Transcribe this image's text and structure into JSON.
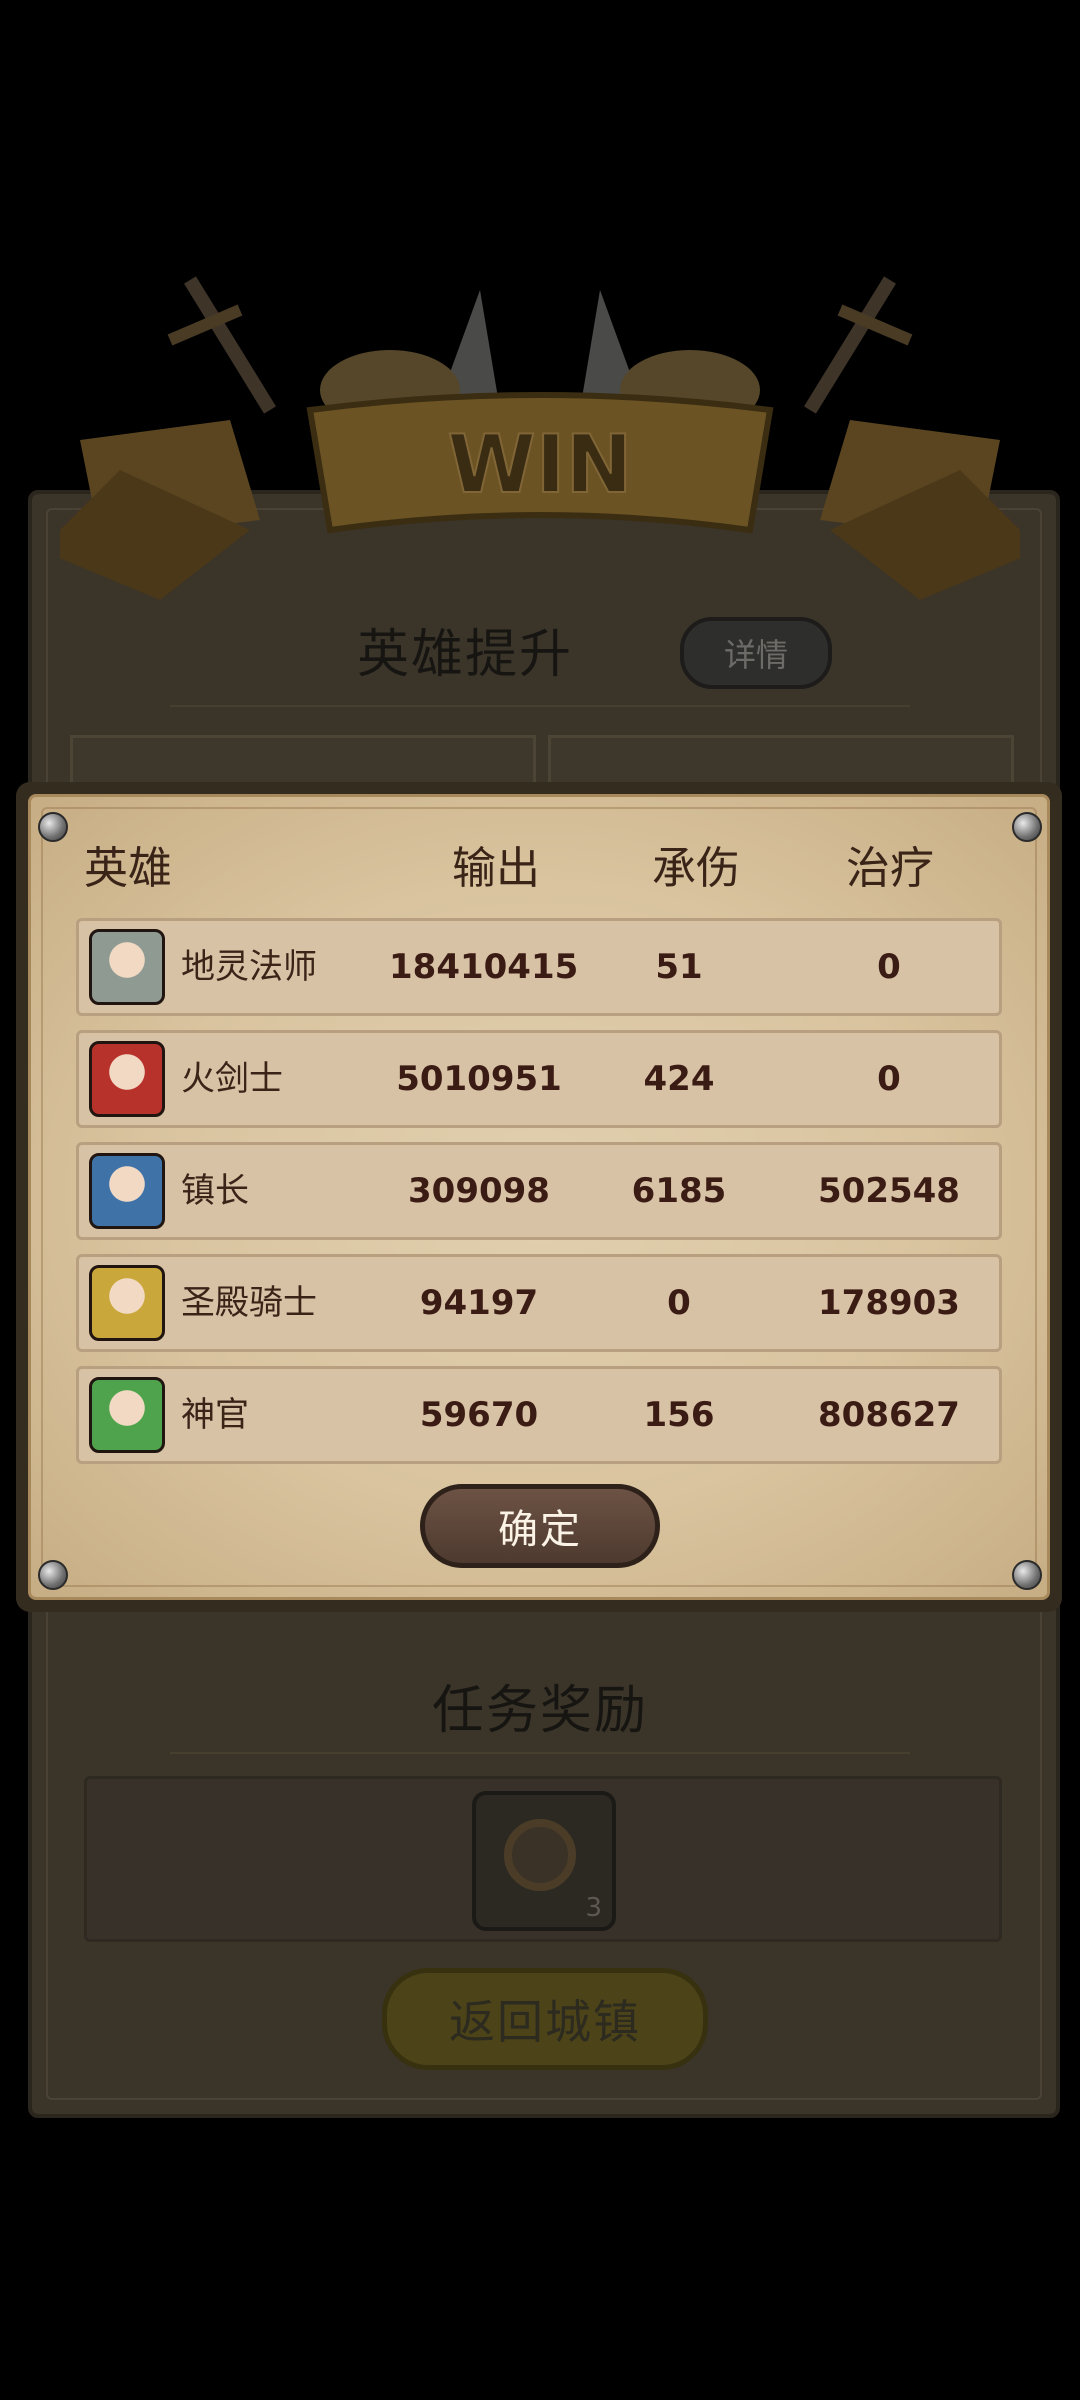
{
  "banner": {
    "text": "WIN"
  },
  "hero_upgrade": {
    "title": "英雄提升",
    "detail_button": "详情"
  },
  "task": {
    "title": "任务奖励",
    "reward_count": "3"
  },
  "return_button": "返回城镇",
  "popup": {
    "headers": {
      "hero": "英雄",
      "output": "输出",
      "damage_taken": "承伤",
      "healing": "治疗"
    },
    "rows": [
      {
        "name": "地灵法师",
        "output": "18410415",
        "taken": "51",
        "heal": "0",
        "avatar_color": "#8f9b92"
      },
      {
        "name": "火剑士",
        "output": "5010951",
        "taken": "424",
        "heal": "0",
        "avatar_color": "#b8322c"
      },
      {
        "name": "镇长",
        "output": "309098",
        "taken": "6185",
        "heal": "502548",
        "avatar_color": "#3f73a8"
      },
      {
        "name": "圣殿骑士",
        "output": "94197",
        "taken": "0",
        "heal": "178903",
        "avatar_color": "#c9a73a"
      },
      {
        "name": "神官",
        "output": "59670",
        "taken": "156",
        "heal": "808627",
        "avatar_color": "#4fa34c"
      }
    ],
    "confirm_button": "确定"
  }
}
